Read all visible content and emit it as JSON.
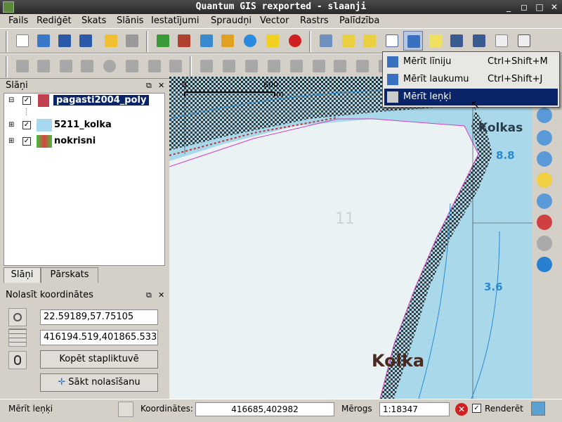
{
  "window": {
    "title": "Quantum GIS rexported - slaanji"
  },
  "menubar": {
    "items": [
      "Fails",
      "Rediģēt",
      "Skats",
      "Slānis",
      "Iestatījumi",
      "Spraudņi",
      "Vector",
      "Rastrs",
      "Palīdzība"
    ]
  },
  "layers_panel": {
    "title": "Slāņi",
    "layers": [
      {
        "name": "pagasti2004_poly",
        "checked": "✓",
        "selected": true
      },
      {
        "name": "5211_kolka",
        "checked": "✓",
        "selected": false
      },
      {
        "name": "nokrisni",
        "checked": "✓",
        "selected": false
      }
    ],
    "tabs": [
      "Slāņi",
      "Pārskats"
    ]
  },
  "coords_panel": {
    "title": "Nolasīt koordinātes",
    "wgs_value": "22.59189,57.75105",
    "proj_value": "416194.519,401865.533",
    "copy_button": "Kopēt stapliktuvē",
    "start_button": "Sākt nolasīšanu"
  },
  "map": {
    "scalebar_left": "0",
    "scalebar_right": "600",
    "scalebar_unit": "m",
    "labels": {
      "kolkasrags": "Kolkas",
      "kolka": "Kolka",
      "depth1": "8.8",
      "depth2": "3.6",
      "eleven": "11"
    }
  },
  "dropdown": {
    "items": [
      {
        "label": "Mērīt līniju",
        "shortcut": "Ctrl+Shift+M"
      },
      {
        "label": "Mērīt laukumu",
        "shortcut": "Ctrl+Shift+J"
      },
      {
        "label": "Mērīt leņķi",
        "shortcut": ""
      }
    ]
  },
  "statusbar": {
    "message": "Mērīt leņķi",
    "coords_label": "Koordinātes:",
    "coords_value": "416685,402982",
    "scale_label": "Mērogs",
    "scale_value": "1:18347",
    "render_label": "Renderēt",
    "render_checked": "✓"
  },
  "colors": {
    "water": "#a8d8ea",
    "land": "#eaf2f4",
    "selection": "#0a246a",
    "boundary": "#d040c0"
  }
}
